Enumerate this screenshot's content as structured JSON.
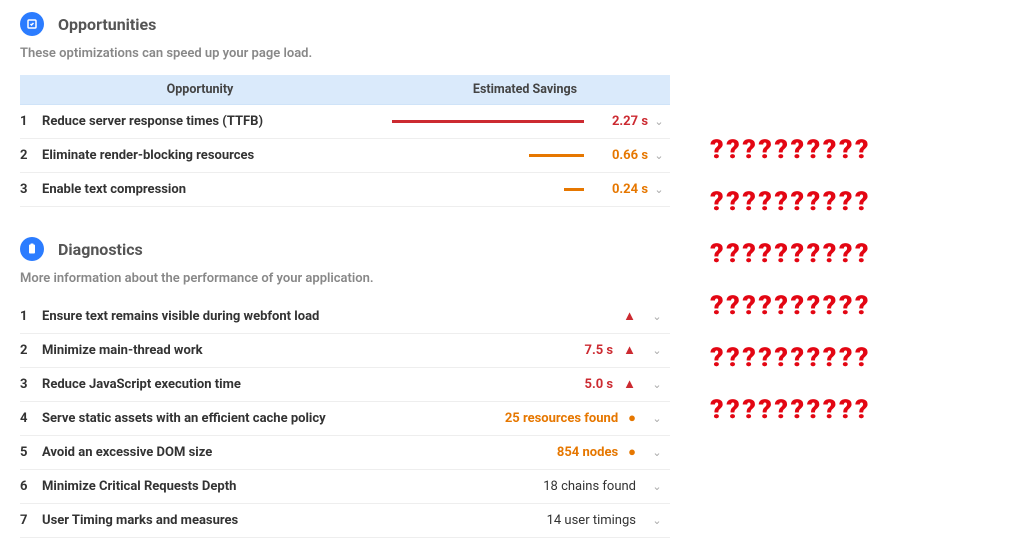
{
  "opportunities": {
    "title": "Opportunities",
    "subtitle": "These optimizations can speed up your page load.",
    "header_opportunity": "Opportunity",
    "header_savings": "Estimated Savings",
    "rows": [
      {
        "idx": "1",
        "label": "Reduce server response times (TTFB)",
        "value": "2.27 s",
        "color": "#cc2a31",
        "width_pct": 95
      },
      {
        "idx": "2",
        "label": "Eliminate render-blocking resources",
        "value": "0.66 s",
        "color": "#e67700",
        "width_pct": 27
      },
      {
        "idx": "3",
        "label": "Enable text compression",
        "value": "0.24 s",
        "color": "#e67700",
        "width_pct": 10
      }
    ]
  },
  "diagnostics": {
    "title": "Diagnostics",
    "subtitle": "More information about the performance of your application.",
    "rows": [
      {
        "idx": "1",
        "label": "Ensure text remains visible during webfont load",
        "value": "",
        "value_class": "",
        "status": "triangle"
      },
      {
        "idx": "2",
        "label": "Minimize main-thread work",
        "value": "7.5 s",
        "value_class": "val-red",
        "status": "triangle"
      },
      {
        "idx": "3",
        "label": "Reduce JavaScript execution time",
        "value": "5.0 s",
        "value_class": "val-red",
        "status": "triangle"
      },
      {
        "idx": "4",
        "label": "Serve static assets with an efficient cache policy",
        "value": "25 resources found",
        "value_class": "val-orange",
        "status": "circle"
      },
      {
        "idx": "5",
        "label": "Avoid an excessive DOM size",
        "value": "854 nodes",
        "value_class": "val-orange",
        "status": "circle"
      },
      {
        "idx": "6",
        "label": "Minimize Critical Requests Depth",
        "value": "18 chains found",
        "value_class": "val-plain",
        "status": ""
      },
      {
        "idx": "7",
        "label": "User Timing marks and measures",
        "value": "14 user timings",
        "value_class": "val-plain",
        "status": ""
      }
    ]
  },
  "qmarks": "??????????"
}
